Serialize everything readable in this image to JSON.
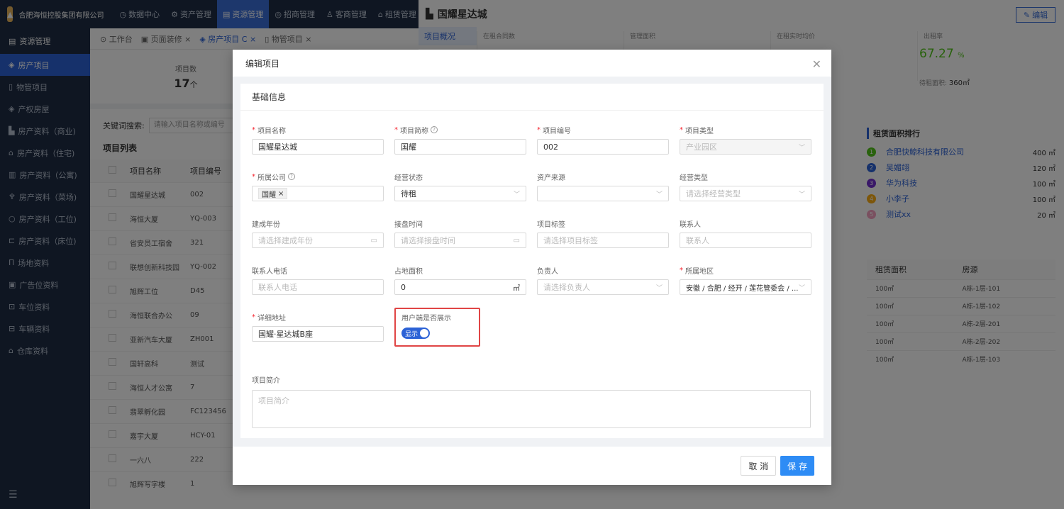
{
  "topbar": {
    "company": "合肥海恒控股集团有限公司",
    "nav": [
      {
        "label": "数据中心",
        "icon": "clock-icon"
      },
      {
        "label": "资产管理",
        "icon": "gear-icon"
      },
      {
        "label": "资源管理",
        "icon": "building-icon",
        "active": true
      },
      {
        "label": "招商管理",
        "icon": "target-icon"
      },
      {
        "label": "客商管理",
        "icon": "users-icon"
      },
      {
        "label": "租赁管理",
        "icon": "house-icon"
      }
    ]
  },
  "sidebar": {
    "header": "资源管理",
    "items": [
      {
        "label": "房产项目",
        "active": true
      },
      {
        "label": "物管项目"
      },
      {
        "label": "产权房屋"
      },
      {
        "label": "房产资料（商业)"
      },
      {
        "label": "房产资料（住宅)"
      },
      {
        "label": "房产资料（公寓)"
      },
      {
        "label": "房产资料（菜场)"
      },
      {
        "label": "房产资料（工位)"
      },
      {
        "label": "房产资料（床位)"
      },
      {
        "label": "场地资料"
      },
      {
        "label": "广告位资料"
      },
      {
        "label": "车位资料"
      },
      {
        "label": "车辆资料"
      },
      {
        "label": "仓库资料"
      }
    ]
  },
  "tabs": [
    {
      "label": "工作台"
    },
    {
      "label": "页面装修 ×"
    },
    {
      "label": "房产项目 C ×",
      "active": true
    },
    {
      "label": "物管项目 ×"
    }
  ],
  "stats": {
    "label": "项目数",
    "value": "17",
    "unit": "个"
  },
  "search": {
    "label": "关键词搜索:",
    "placeholder": "请输入项目名称或编号"
  },
  "list": {
    "title": "项目列表",
    "headers": [
      "项目名称",
      "项目编号"
    ],
    "rows": [
      [
        "国耀星达城",
        "002"
      ],
      [
        "海恒大厦",
        "YQ-003"
      ],
      [
        "省安员工宿舍",
        "321"
      ],
      [
        "联想创新科技园",
        "YQ-002"
      ],
      [
        "旭辉工位",
        "D45"
      ],
      [
        "海恒联合办公",
        "09"
      ],
      [
        "亚新汽车大厦",
        "ZH001"
      ],
      [
        "国轩高科",
        "测试"
      ],
      [
        "海恒人才公寓",
        "7"
      ],
      [
        "翡翠孵化园",
        "FC123456"
      ],
      [
        "嘉宇大厦",
        "HCY-01"
      ],
      [
        "一六八",
        "222"
      ],
      [
        "旭辉写字楼",
        "1"
      ]
    ]
  },
  "detail": {
    "title": "国耀星达城",
    "edit_label": "编辑",
    "side_tab": "项目概况",
    "metrics": [
      "在租合同数",
      "管理面积",
      "在租实时均价",
      "出租率"
    ],
    "rent_rate": "67.27",
    "rent_rate_unit": "%",
    "vacant_label": "待租面积:",
    "vacant_value": "360㎡",
    "rank_title": "租赁面积排行",
    "ranks": [
      {
        "name": "合肥快鲸科技有限公司",
        "area": "400 ㎡",
        "color": "#52c41a"
      },
      {
        "name": "吴媚翊",
        "area": "120 ㎡",
        "color": "#2c62d6"
      },
      {
        "name": "华为科技",
        "area": "100 ㎡",
        "color": "#722ed1"
      },
      {
        "name": "小李子",
        "area": "100 ㎡",
        "color": "#faad14"
      },
      {
        "name": "测试xx",
        "area": "20 ㎡",
        "color": "#f5a0c0"
      }
    ],
    "rent_headers": [
      "租赁面积",
      "房源"
    ],
    "rent_rows": [
      [
        "100㎡",
        "A栋-1层-101"
      ],
      [
        "100㎡",
        "A栋-1层-102"
      ],
      [
        "100㎡",
        "A栋-2层-201"
      ],
      [
        "100㎡",
        "A栋-2层-202"
      ],
      [
        "100㎡",
        "A栋-1层-103"
      ]
    ]
  },
  "modal": {
    "title": "编辑项目",
    "section_title": "基础信息",
    "fields": {
      "name": {
        "label": "项目名称",
        "value": "国耀星达城"
      },
      "short": {
        "label": "项目简称",
        "value": "国耀"
      },
      "code": {
        "label": "项目编号",
        "value": "002"
      },
      "type": {
        "label": "项目类型",
        "value": "产业园区"
      },
      "company": {
        "label": "所属公司",
        "tag": "国耀"
      },
      "status": {
        "label": "经营状态",
        "value": "待租"
      },
      "source": {
        "label": "资产来源",
        "value": ""
      },
      "biz_type": {
        "label": "经营类型",
        "placeholder": "请选择经营类型"
      },
      "build_year": {
        "label": "建成年份",
        "placeholder": "请选择建成年份"
      },
      "takeover": {
        "label": "接盘时间",
        "placeholder": "请选择接盘时间"
      },
      "tags": {
        "label": "项目标签",
        "placeholder": "请选择项目标签"
      },
      "contact": {
        "label": "联系人",
        "placeholder": "联系人"
      },
      "phone": {
        "label": "联系人电话",
        "placeholder": "联系人电话"
      },
      "area": {
        "label": "占地面积",
        "value": "0",
        "unit": "㎡"
      },
      "manager": {
        "label": "负责人",
        "placeholder": "请选择负责人"
      },
      "region": {
        "label": "所属地区",
        "value": "安徽 / 合肥 / 经开 / 莲花管委会 / ..."
      },
      "address": {
        "label": "详细地址",
        "value": "国耀·星达城B座"
      },
      "show": {
        "label": "用户端是否展示",
        "toggle_text": "显示"
      },
      "intro": {
        "label": "项目简介",
        "placeholder": "项目简介"
      }
    },
    "cancel_label": "取 消",
    "save_label": "保 存"
  }
}
